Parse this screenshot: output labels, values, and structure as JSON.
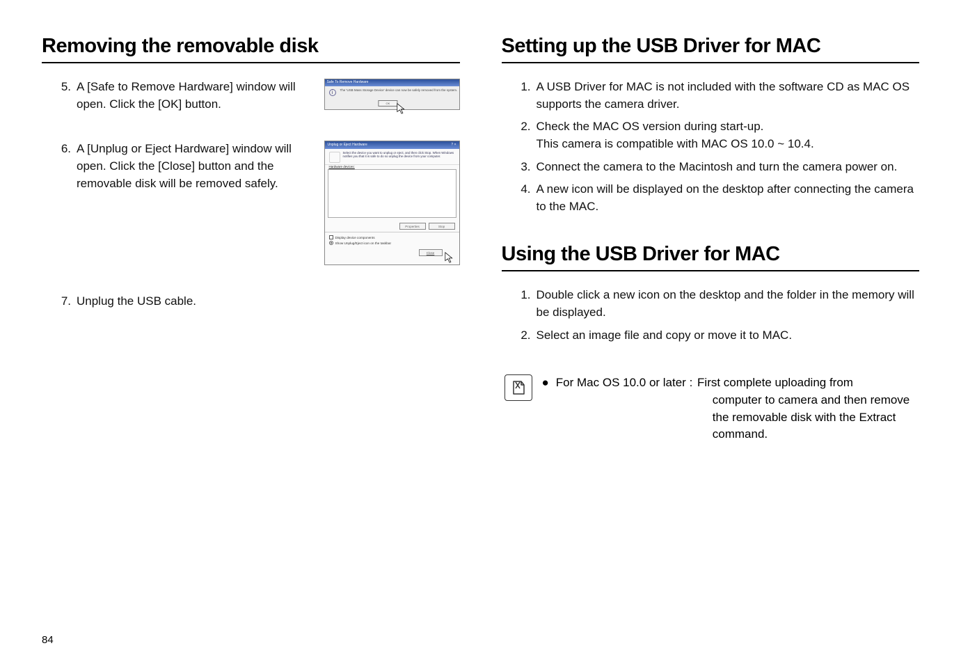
{
  "left": {
    "title": "Removing the removable disk",
    "step5": {
      "num": "5.",
      "text": "A [Safe to Remove Hardware] window will open. Click the [OK] button."
    },
    "step6": {
      "num": "6.",
      "text": "A [Unplug or Eject Hardware] window will open. Click the [Close] button and the removable disk will be removed safely."
    },
    "step7": {
      "num": "7.",
      "text": "Unplug the USB cable."
    },
    "dlg1": {
      "title": "Safe To Remove Hardware",
      "msg": "The 'USB Mass Storage Device' device can now be safely removed from the system.",
      "ok": "OK"
    },
    "dlg2": {
      "title": "Unplug or Eject Hardware",
      "help": "Select the device you want to unplug or eject, and then click Stop. When Windows notifies you that it is safe to do so unplug the device from your computer.",
      "hw_label": "Hardware devices:",
      "properties": "Properties",
      "stop": "Stop",
      "chk": "Display device components",
      "radio": "Show Unplug/Eject icon on the taskbar",
      "close": "Close"
    }
  },
  "right": {
    "title1": "Setting up the USB Driver for MAC",
    "s1": {
      "num": "1.",
      "text": "A USB Driver for MAC is not included with the software CD as MAC OS supports the camera driver."
    },
    "s2": {
      "num": "2.",
      "text1": "Check the MAC OS version during start-up.",
      "text2": "This camera is compatible with MAC OS 10.0 ~ 10.4."
    },
    "s3": {
      "num": "3.",
      "text": "Connect the camera to the Macintosh and turn the camera power on."
    },
    "s4": {
      "num": "4.",
      "text": "A new icon will be displayed on the desktop after connecting the camera to the MAC."
    },
    "title2": "Using the USB Driver for MAC",
    "u1": {
      "num": "1.",
      "text": "Double click a new icon on the desktop and the folder in the memory will be displayed."
    },
    "u2": {
      "num": "2.",
      "text": "Select an image file and copy or move it to MAC."
    },
    "note_lead": "For Mac OS 10.0 or later :",
    "note_first": "First complete uploading from",
    "note_rest1": "computer to camera and then remove",
    "note_rest2": "the removable disk with the Extract",
    "note_rest3": "command."
  },
  "page": "84"
}
